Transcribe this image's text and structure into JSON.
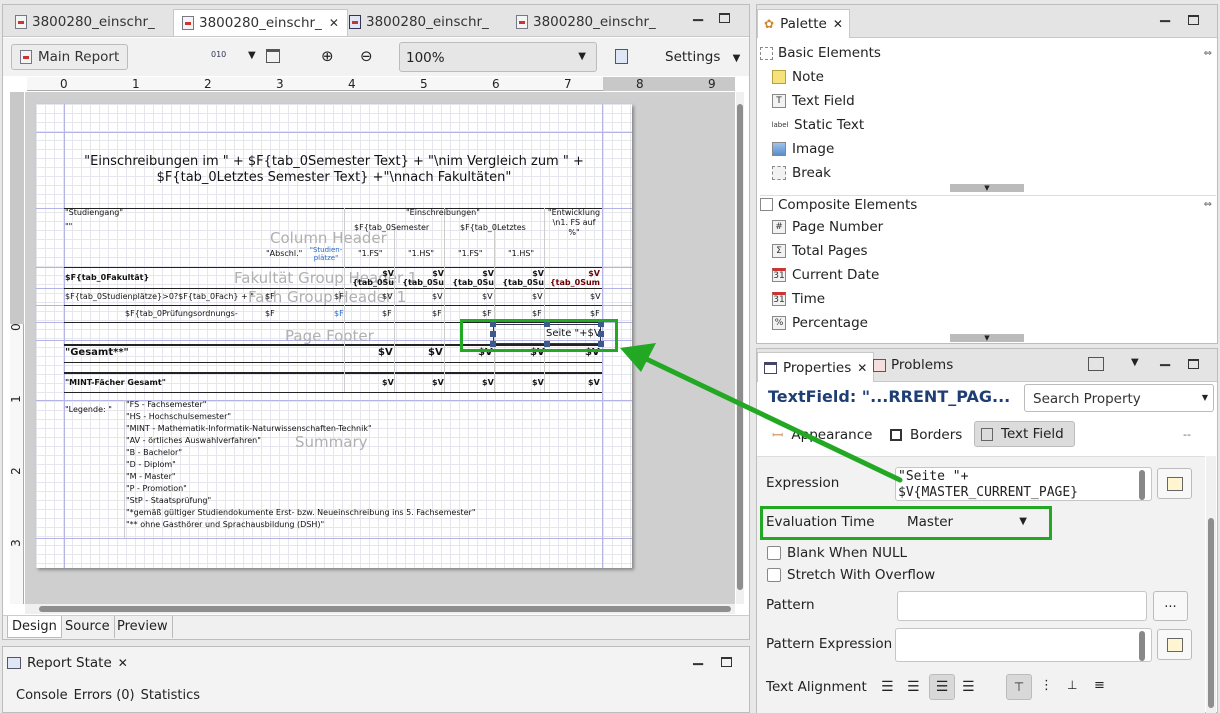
{
  "editor": {
    "tabs": [
      {
        "label": "3800280_einschr_"
      },
      {
        "label": "3800280_einschr_",
        "close": "✕"
      },
      {
        "label": "3800280_einschr_"
      },
      {
        "label": "3800280_einschr_"
      }
    ],
    "toolbar": {
      "main_report": "Main Report",
      "zoom": "100%",
      "settings": "Settings"
    },
    "ruler_h": [
      "0",
      "1",
      "2",
      "3",
      "4",
      "5",
      "6",
      "7",
      "8",
      "9"
    ],
    "ruler_v": [
      "0",
      "1",
      "2",
      "3"
    ],
    "bottom_tabs": [
      "Design",
      "Source",
      "Preview"
    ]
  },
  "report": {
    "title": "\"Einschreibungen im \" + $F{tab_0Semester Text} + \"\\nim Vergleich zum \" + $F{tab_0Letztes Semester Text} +\"\\nnach Fakultäten\"",
    "band_labels": {
      "column_header": "Column Header",
      "fak_group": "Fakultät Group Header 1",
      "fach_group": "Fach Group Header 1",
      "page_footer": "Page Footer",
      "summary": "Summary"
    },
    "headers": {
      "studiengang": "\"Studiengang\"",
      "empty": "\"\"",
      "einschreibungen": "\"Einschreibungen\"",
      "entwicklung": "\"Entwicklung \\n1. FS auf %\"",
      "semester": "$F{tab_0Semester",
      "letztes": "$F{tab_0Letztes",
      "abschl": "\"Abschl.\"",
      "studienplaetze": "\"Studien-plätze\"",
      "fs1a": "\"1.FS\"",
      "hs1a": "\"1.HS\"",
      "fs1b": "\"1.FS\"",
      "hs1b": "\"1.HS\""
    },
    "fak_row": {
      "label": "$F{tab_0Fakultät}",
      "c1": "$V {tab_0Su",
      "c2": "$V {tab_0Su",
      "c3": "$V {tab_0Su",
      "c4": "$V {tab_0Su",
      "c5": "$V {tab_0Sum"
    },
    "fach_row": {
      "label": "$F{tab_0Studienplätze}>0?$F{tab_0Fach} + \"",
      "f1": "$F",
      "f2": "$F",
      "v1": "$V",
      "v2": "$V",
      "v3": "$V",
      "v4": "$V",
      "v5": "$V"
    },
    "pruef_row": {
      "label": "$F{tab_0Prüfungsordnungs-",
      "f1": "$F",
      "f2": "$F",
      "f3": "$F",
      "f4": "$F",
      "f5": "$F",
      "f6": "$F",
      "f7": "$F"
    },
    "footer_field": "Seite \"+$V",
    "gesamt": {
      "label": "\"Gesamt**\"",
      "v": "$V"
    },
    "mint": {
      "label": "\"MINT-Fächer Gesamt\"",
      "v": "$V"
    },
    "legende_label": "\"Legende: \"",
    "legend": [
      "\"FS - Fachsemester\"",
      "\"HS - Hochschulsemester\"",
      "\"MINT - Mathematik-Informatik-Naturwissenschaften-Technik\"",
      "\"AV - örtliches Auswahlverfahren\"",
      "\"B - Bachelor\"",
      "\"D - Diplom\"",
      "\"M - Master\"",
      "\"P - Promotion\"",
      "\"StP - Staatsprüfung\"",
      "\"*gemäß gültiger Studiendokumente Erst- bzw. Neueinschreibung ins 5. Fachsemester\"",
      "\"** ohne Gasthörer und Sprachausbildung (DSH)\""
    ]
  },
  "report_state": {
    "title": "Report State",
    "tabs": [
      "Console",
      "Errors (0)",
      "Statistics"
    ]
  },
  "palette": {
    "title": "Palette",
    "basic_title": "Basic Elements",
    "basic": [
      {
        "label": "Note",
        "icon": "note-icon"
      },
      {
        "label": "Text Field",
        "icon": "text-field-icon"
      },
      {
        "label": "Static Text",
        "icon": "static-text-icon",
        "badge": "label"
      },
      {
        "label": "Image",
        "icon": "image-icon"
      },
      {
        "label": "Break",
        "icon": "break-icon"
      }
    ],
    "composite_title": "Composite Elements",
    "composite": [
      {
        "label": "Page Number",
        "icon": "page-number-icon",
        "badge": "#"
      },
      {
        "label": "Total Pages",
        "icon": "total-pages-icon",
        "badge": "Σ"
      },
      {
        "label": "Current Date",
        "icon": "current-date-icon",
        "badge": "31"
      },
      {
        "label": "Time",
        "icon": "time-icon",
        "badge": "31"
      },
      {
        "label": "Percentage",
        "icon": "percentage-icon",
        "badge": "%"
      }
    ]
  },
  "properties": {
    "title": "Properties",
    "problems": "Problems",
    "element_title": "TextField: \"...RRENT_PAG...",
    "search_placeholder": "Search Property",
    "subtabs": [
      "Appearance",
      "Borders",
      "Text Field"
    ],
    "more": "--",
    "expression_label": "Expression",
    "expression_line1": "\"Seite \"+",
    "expression_line2": "$V{MASTER_CURRENT_PAGE}",
    "evaluation_label": "Evaluation Time",
    "evaluation_value": "Master",
    "blank_null": "Blank When NULL",
    "stretch_overflow": "Stretch With Overflow",
    "pattern_label": "Pattern",
    "pattern_btn": "...",
    "pattern_expr_label": "Pattern Expression",
    "text_alignment_label": "Text Alignment"
  },
  "colors": {
    "highlight": "#22a822",
    "title_blue": "#1f3e73"
  }
}
